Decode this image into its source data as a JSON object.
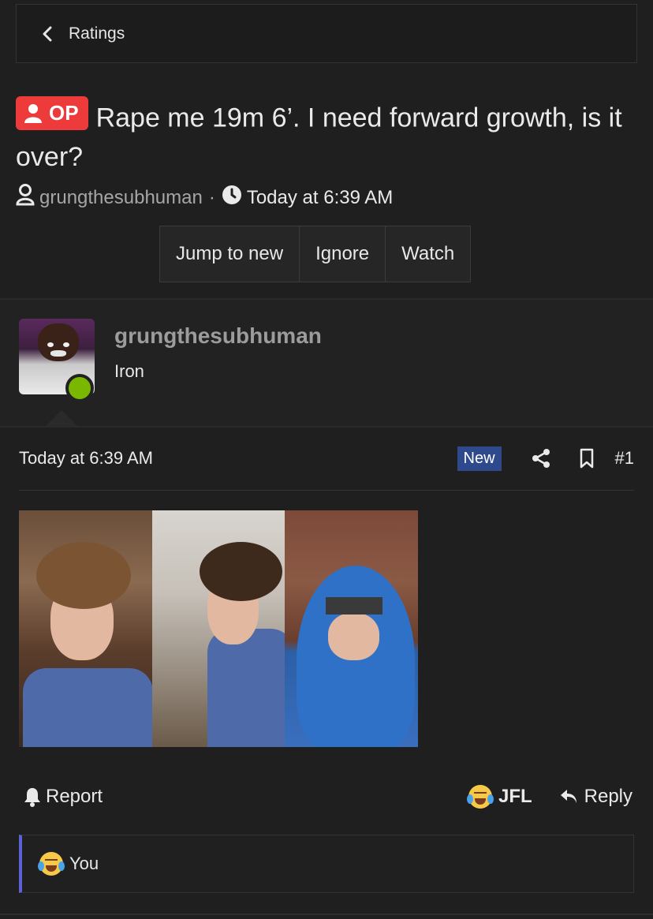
{
  "breadcrumb": {
    "label": "Ratings"
  },
  "thread": {
    "op_badge": "OP",
    "title": "Rape me 19m 6’. I need forward growth, is it over?",
    "author": "grungthesubhuman",
    "separator": "·",
    "time": "Today at 6:39 AM"
  },
  "actions_top": {
    "jump": "Jump to new",
    "ignore": "Ignore",
    "watch": "Watch"
  },
  "post": {
    "author_name": "grungthesubhuman",
    "author_rank": "Iron",
    "time": "Today at 6:39 AM",
    "new_badge": "New",
    "number": "#1"
  },
  "post_actions": {
    "report": "Report",
    "jfl": "JFL",
    "reply": "Reply"
  },
  "reactions": {
    "text": "You"
  },
  "colors": {
    "background": "#1f1f1f",
    "op_badge": "#ec3b3a",
    "online": "#7ab800",
    "new_badge": "#2f4a8c",
    "reaction_bar": "#5c62d6"
  },
  "icons": [
    "chevron-left-icon",
    "user-icon",
    "clock-icon",
    "share-icon",
    "bookmark-icon",
    "bell-icon",
    "laughing-crying-emoji-icon",
    "reply-icon"
  ]
}
